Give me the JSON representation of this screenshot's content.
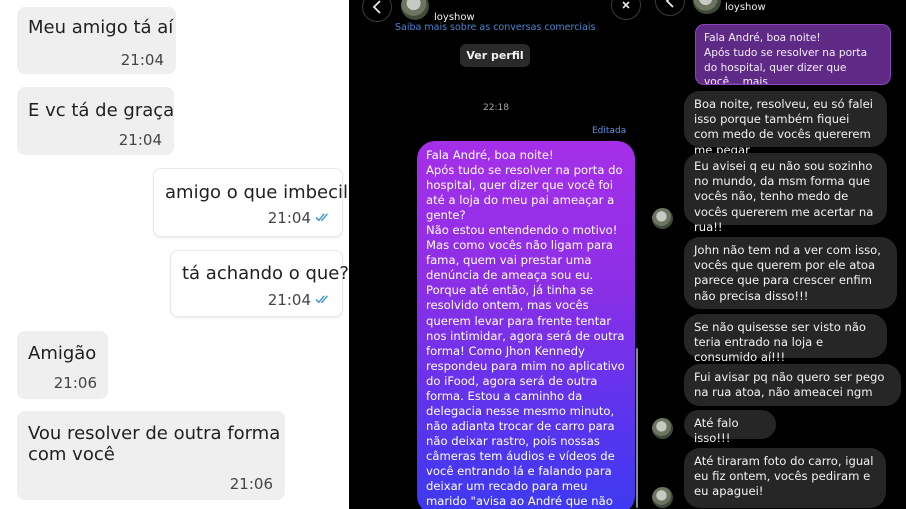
{
  "whatsapp": {
    "messages": [
      {
        "text": "Meu amigo tá aí",
        "time": "21:04"
      },
      {
        "text": "E vc tá de graça",
        "time": "21:04"
      },
      {
        "text": "amigo o que imbecil",
        "time": "21:04"
      },
      {
        "text": "tá achando o que?",
        "time": "21:04"
      },
      {
        "text": "Amigão",
        "time": "21:06"
      },
      {
        "text": "Vou resolver de outra forma\ncom você",
        "time": "21:06"
      }
    ],
    "tick_color": "#3b95d6"
  },
  "instagram_left": {
    "username": "loyshow",
    "business_link": "Saiba mais sobre as conversas comerciais",
    "view_profile": "Ver perfil",
    "timestamp": "22:18",
    "edited_label": "Editada",
    "message": "Fala André, boa noite!\nApós tudo se resolver na porta do hospital, quer dizer que você foi até a loja do meu pai ameaçar a gente?\nNão estou entendendo o motivo!\nMas como vocês não ligam para fama, quem vai prestar uma denúncia de ameaça sou eu.\nPorque até então, já tinha se resolvido ontem, mas vocês querem levar para frente tentar nos intimidar, agora será de outra forma! Como Jhon Kennedy respondeu para mim no aplicativo do iFood, agora será de outra forma. Estou a caminho da delegacia nesse mesmo minuto, não adianta trocar de carro para não deixar rastro, pois nossas câmeras tem áudios e vídeos de você entrando lá e falando para deixar um recado para meu marido \"avisa ao André que não andamos sozinho\"",
    "colors": {
      "bubble_top": "#a62fe9",
      "bubble_bottom": "#3c3af1"
    }
  },
  "instagram_right": {
    "username": "loyshow",
    "reply_preview": "Fala André, boa noite!\nApós tudo se resolver na porta do hospital, quer dizer que você... mais",
    "messages": [
      "Boa noite, resolveu, eu só falei isso porque também fiquei com medo de vocês quererem me pegar",
      "Eu avisei q eu não sou sozinho no mundo, da msm forma que vocês não, tenho medo de vocês quererem me acertar na rua!!",
      "John não tem nd a ver com isso, vocês que querem por ele atoa parece que para crescer enfim não precisa disso!!!",
      "Se não quisesse ser visto não teria entrado na loja e consumido aí!!!",
      "Fui avisar pq não quero ser pego na rua atoa, não ameacei ngm",
      "Até falo isso!!!",
      "Até tiraram foto do carro, igual eu fiz ontem, vocês pediram e eu apaguei!"
    ]
  }
}
